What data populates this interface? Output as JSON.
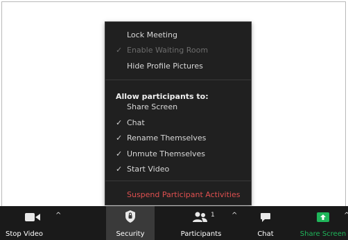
{
  "menu": {
    "items_top": [
      {
        "label": "Lock Meeting",
        "checked": false,
        "disabled": false
      },
      {
        "label": "Enable Waiting Room",
        "checked": true,
        "disabled": true
      },
      {
        "label": "Hide Profile Pictures",
        "checked": false,
        "disabled": false
      }
    ],
    "allow_header": "Allow participants to:",
    "allow_items": [
      {
        "label": "Share Screen",
        "checked": false
      },
      {
        "label": "Chat",
        "checked": true
      },
      {
        "label": "Rename Themselves",
        "checked": true
      },
      {
        "label": "Unmute Themselves",
        "checked": true
      },
      {
        "label": "Start Video",
        "checked": true
      }
    ],
    "danger_item": "Suspend Participant Activities",
    "check_glyph": "✓",
    "colors": {
      "danger": "#e05050",
      "share_green": "#1fb65a"
    }
  },
  "toolbar": {
    "stop_video": "Stop Video",
    "security": "Security",
    "participants": "Participants",
    "participants_count": "1",
    "chat": "Chat",
    "share_screen": "Share Screen",
    "caret_glyph": "^"
  }
}
